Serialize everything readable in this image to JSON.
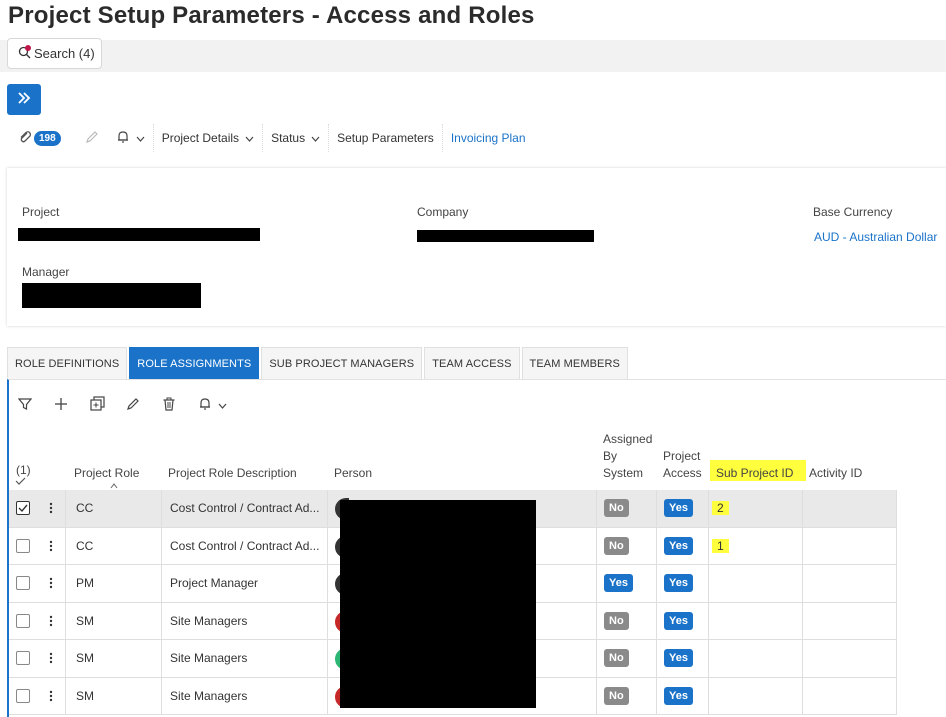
{
  "page": {
    "title": "Project Setup Parameters - Access and Roles"
  },
  "search": {
    "label": "Search (4)"
  },
  "toolbar": {
    "attachments_count": "198",
    "project_details": "Project Details",
    "status": "Status",
    "setup_parameters": "Setup Parameters",
    "invoicing_plan": "Invoicing Plan"
  },
  "header": {
    "project_label": "Project",
    "company_label": "Company",
    "base_currency_label": "Base Currency",
    "base_currency_value": "AUD - Australian Dollar",
    "manager_label": "Manager"
  },
  "tabs": [
    {
      "label": "ROLE DEFINITIONS"
    },
    {
      "label": "ROLE ASSIGNMENTS"
    },
    {
      "label": "SUB PROJECT MANAGERS"
    },
    {
      "label": "TEAM ACCESS"
    },
    {
      "label": "TEAM MEMBERS"
    }
  ],
  "grid": {
    "selected_count": "(1)",
    "columns": {
      "project_role": "Project Role",
      "project_role_description": "Project Role Description",
      "person": "Person",
      "assigned_by_system_1": "Assigned",
      "assigned_by_system_2": "By",
      "assigned_by_system_3": "System",
      "project_access_1": "Project",
      "project_access_2": "Access",
      "sub_project_id": "Sub Project ID",
      "activity_id": "Activity ID"
    },
    "rows": [
      {
        "role": "CC",
        "description": "Cost Control / Contract Ad...",
        "assigned": "No",
        "access": "Yes",
        "sub_project_id": "2",
        "selected": true
      },
      {
        "role": "CC",
        "description": "Cost Control / Contract Ad...",
        "assigned": "No",
        "access": "Yes",
        "sub_project_id": "1",
        "selected": false
      },
      {
        "role": "PM",
        "description": "Project Manager",
        "assigned": "Yes",
        "access": "Yes",
        "sub_project_id": "",
        "selected": false
      },
      {
        "role": "SM",
        "description": "Site Managers",
        "assigned": "No",
        "access": "Yes",
        "sub_project_id": "",
        "selected": false
      },
      {
        "role": "SM",
        "description": "Site Managers",
        "assigned": "No",
        "access": "Yes",
        "sub_project_id": "",
        "selected": false
      },
      {
        "role": "SM",
        "description": "Site Managers",
        "assigned": "No",
        "access": "Yes",
        "sub_project_id": "",
        "selected": false
      }
    ]
  },
  "colors": {
    "accent": "#1a73c9",
    "highlight": "#ffff3d",
    "no_pill": "#8a8a8a"
  }
}
